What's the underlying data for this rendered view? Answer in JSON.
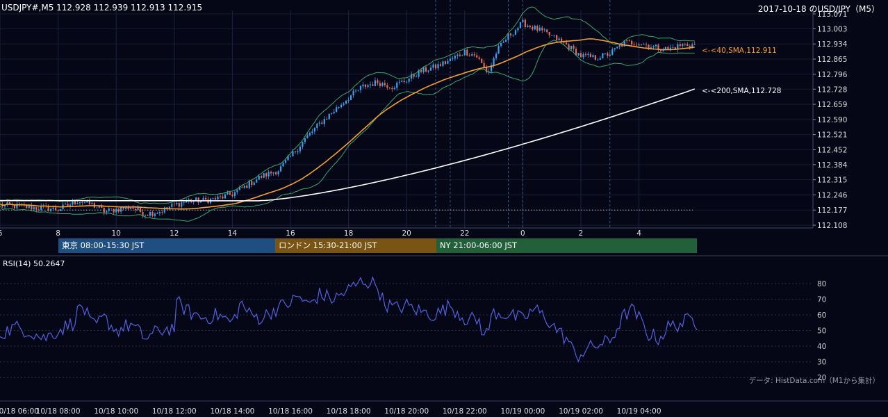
{
  "header": {
    "left": "USDJPY#,M5 112.928 112.939 112.913 112.915",
    "right": "2017-10-18 のUSD/JPY（M5）"
  },
  "sessions": [
    {
      "label": "東京 08:00-15:30 JST",
      "color": "#1f4f80"
    },
    {
      "label": "ロンドン 15:30-21:00 JST",
      "color": "#7a5413"
    },
    {
      "label": "NY 21:00-06:00 JST",
      "color": "#22603a"
    }
  ],
  "rsi": {
    "label": "RSI(14) 50.2647"
  },
  "source": "データ: HistData.com（M1から集計）",
  "colors": {
    "background": "#060716",
    "candle_up": "#3aa0ef",
    "candle_down": "#e06c5a",
    "sma40": "#f5a030",
    "sma200": "#ffffff",
    "bollinger": "#3aa869",
    "rsi": "#5461e0"
  },
  "chart_data": [
    {
      "type": "candlestick",
      "title": "",
      "ylim": [
        112.108,
        113.071
      ],
      "yticks": [
        "113.071",
        "113.003",
        "112.934",
        "112.865",
        "112.796",
        "112.728",
        "112.659",
        "112.590",
        "112.521",
        "112.452",
        "112.384",
        "112.315",
        "112.246",
        "112.177",
        "112.108"
      ],
      "x_hour_ticks": [
        "6",
        "8",
        "10",
        "12",
        "14",
        "16",
        "18",
        "20",
        "22",
        "0",
        "2",
        "4"
      ],
      "x_session_lines": [
        "21:00",
        "21:30",
        "23:30",
        "0:00",
        "3:00"
      ],
      "reference_level": 112.177,
      "series": [
        {
          "name": "40,SMA",
          "last_label": "<-<40,SMA,112.911",
          "last": 112.911
        },
        {
          "name": "200,SMA",
          "last_label": "<-<200,SMA,112.728",
          "last": 112.728
        }
      ],
      "anchors_hour_close": [
        [
          6.0,
          112.2
        ],
        [
          7.0,
          112.19
        ],
        [
          8.0,
          112.18
        ],
        [
          8.7,
          112.22
        ],
        [
          9.2,
          112.2
        ],
        [
          9.6,
          112.17
        ],
        [
          10.0,
          112.18
        ],
        [
          10.5,
          112.19
        ],
        [
          11.0,
          112.16
        ],
        [
          11.5,
          112.17
        ],
        [
          12.0,
          112.2
        ],
        [
          12.5,
          112.22
        ],
        [
          13.0,
          112.22
        ],
        [
          13.5,
          112.23
        ],
        [
          14.0,
          112.25
        ],
        [
          14.5,
          112.29
        ],
        [
          15.0,
          112.33
        ],
        [
          15.6,
          112.36
        ],
        [
          16.0,
          112.42
        ],
        [
          16.5,
          112.5
        ],
        [
          17.0,
          112.57
        ],
        [
          17.5,
          112.63
        ],
        [
          18.0,
          112.69
        ],
        [
          18.5,
          112.74
        ],
        [
          19.0,
          112.76
        ],
        [
          19.5,
          112.74
        ],
        [
          20.0,
          112.77
        ],
        [
          20.5,
          112.81
        ],
        [
          21.0,
          112.83
        ],
        [
          21.5,
          112.86
        ],
        [
          22.0,
          112.9
        ],
        [
          22.4,
          112.88
        ],
        [
          22.8,
          112.8
        ],
        [
          23.1,
          112.9
        ],
        [
          23.5,
          112.97
        ],
        [
          24.0,
          113.03
        ],
        [
          24.5,
          113.0
        ],
        [
          25.0,
          112.97
        ],
        [
          25.5,
          112.93
        ],
        [
          26.0,
          112.88
        ],
        [
          26.5,
          112.87
        ],
        [
          27.0,
          112.89
        ],
        [
          27.5,
          112.94
        ],
        [
          28.0,
          112.94
        ],
        [
          28.5,
          112.92
        ],
        [
          29.0,
          112.91
        ],
        [
          29.5,
          112.93
        ],
        [
          29.9,
          112.93
        ]
      ]
    },
    {
      "type": "line",
      "title": "",
      "ylim": [
        17,
        88
      ],
      "yticks": [
        "80",
        "70",
        "60",
        "50",
        "40",
        "30",
        "20"
      ],
      "x_tick_labels": [
        "10/18 06:00",
        "10/18 08:00",
        "10/18 10:00",
        "10/18 12:00",
        "10/18 14:00",
        "10/18 16:00",
        "10/18 18:00",
        "10/18 20:00",
        "10/18 22:00",
        "10/19 00:00",
        "10/19 02:00",
        "10/19 04:00"
      ],
      "last": 50.2647,
      "anchors_hour_value": [
        [
          6.0,
          48
        ],
        [
          6.5,
          52
        ],
        [
          7.0,
          50
        ],
        [
          7.5,
          45
        ],
        [
          8.0,
          50
        ],
        [
          8.5,
          55
        ],
        [
          8.8,
          67
        ],
        [
          9.2,
          52
        ],
        [
          9.6,
          58
        ],
        [
          10.0,
          50
        ],
        [
          10.5,
          54
        ],
        [
          11.0,
          45
        ],
        [
          11.5,
          50
        ],
        [
          12.0,
          52
        ],
        [
          12.1,
          68
        ],
        [
          12.5,
          62
        ],
        [
          13.0,
          58
        ],
        [
          13.5,
          60
        ],
        [
          14.0,
          55
        ],
        [
          14.3,
          68
        ],
        [
          14.6,
          60
        ],
        [
          15.0,
          58
        ],
        [
          15.5,
          64
        ],
        [
          16.0,
          68
        ],
        [
          16.3,
          72
        ],
        [
          16.6,
          66
        ],
        [
          17.0,
          73
        ],
        [
          17.5,
          70
        ],
        [
          18.0,
          76
        ],
        [
          18.5,
          82
        ],
        [
          19.0,
          79
        ],
        [
          19.2,
          68
        ],
        [
          19.6,
          64
        ],
        [
          20.0,
          66
        ],
        [
          20.5,
          62
        ],
        [
          21.0,
          60
        ],
        [
          21.5,
          66
        ],
        [
          22.0,
          58
        ],
        [
          22.5,
          56
        ],
        [
          22.7,
          45
        ],
        [
          23.0,
          62
        ],
        [
          23.5,
          60
        ],
        [
          24.0,
          57
        ],
        [
          24.4,
          64
        ],
        [
          24.8,
          58
        ],
        [
          25.2,
          50
        ],
        [
          25.6,
          43
        ],
        [
          25.8,
          33
        ],
        [
          26.2,
          38
        ],
        [
          26.6,
          41
        ],
        [
          27.0,
          43
        ],
        [
          27.4,
          57
        ],
        [
          27.7,
          64
        ],
        [
          28.0,
          58
        ],
        [
          28.3,
          48
        ],
        [
          28.7,
          45
        ],
        [
          29.0,
          52
        ],
        [
          29.5,
          55
        ],
        [
          29.9,
          58
        ],
        [
          30.0,
          50.26
        ]
      ]
    }
  ]
}
